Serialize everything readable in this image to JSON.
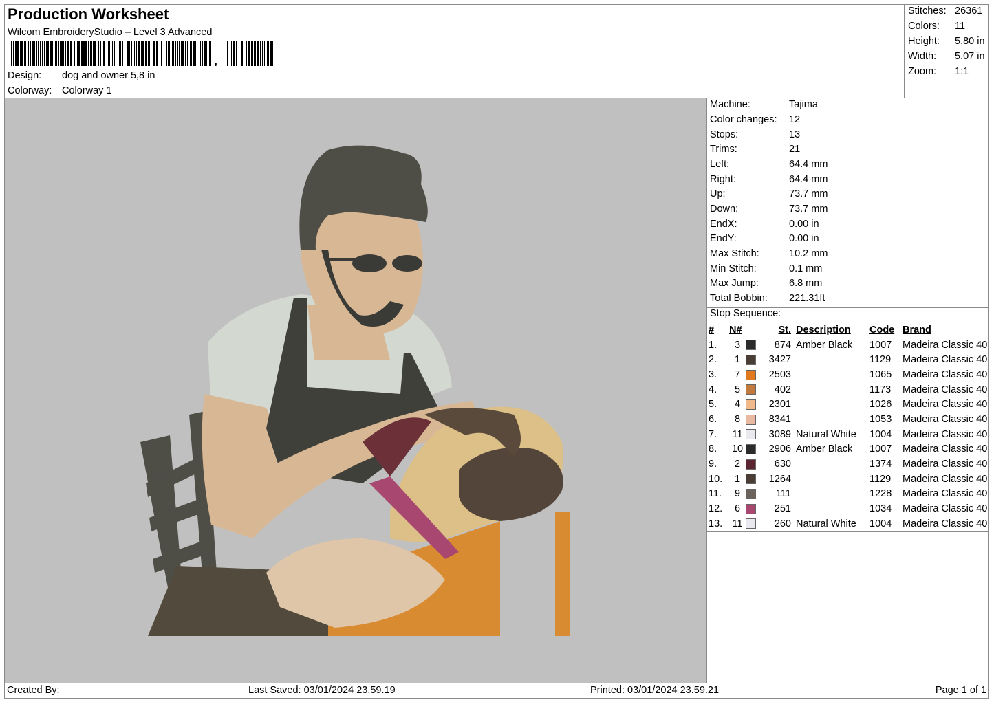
{
  "header": {
    "title": "Production Worksheet",
    "software": "Wilcom EmbroideryStudio – Level 3 Advanced",
    "design_label": "Design:",
    "design_value": "dog and  owner 5,8 in",
    "colorway_label": "Colorway:",
    "colorway_value": "Colorway 1"
  },
  "summary": [
    {
      "label": "Stitches:",
      "value": "26361"
    },
    {
      "label": "Colors:",
      "value": "11"
    },
    {
      "label": "Height:",
      "value": "5.80 in"
    },
    {
      "label": "Width:",
      "value": "5.07 in"
    },
    {
      "label": "Zoom:",
      "value": "1:1"
    }
  ],
  "machine_info": [
    {
      "label": "Machine:",
      "value": "Tajima"
    },
    {
      "label": "Color changes:",
      "value": "12"
    },
    {
      "label": "Stops:",
      "value": "13"
    },
    {
      "label": "Trims:",
      "value": "21"
    },
    {
      "label": "Left:",
      "value": "64.4 mm"
    },
    {
      "label": "Right:",
      "value": "64.4 mm"
    },
    {
      "label": "Up:",
      "value": "73.7 mm"
    },
    {
      "label": "Down:",
      "value": "73.7 mm"
    },
    {
      "label": "EndX:",
      "value": "0.00 in"
    },
    {
      "label": "EndY:",
      "value": "0.00 in"
    },
    {
      "label": "Max Stitch:",
      "value": "10.2 mm"
    },
    {
      "label": "Min Stitch:",
      "value": "0.1 mm"
    },
    {
      "label": "Max Jump:",
      "value": "6.8 mm"
    },
    {
      "label": "Total Bobbin:",
      "value": "221.31ft"
    }
  ],
  "stop_sequence": {
    "title": "Stop Sequence:",
    "columns": [
      "#",
      "N#",
      "St.",
      "Description",
      "Code",
      "Brand"
    ],
    "rows": [
      {
        "num": "1.",
        "n": "3",
        "color": "#2b2b2b",
        "st": "874",
        "desc": "Amber Black",
        "code": "1007",
        "brand": "Madeira Classic 40"
      },
      {
        "num": "2.",
        "n": "1",
        "color": "#4a3d36",
        "st": "3427",
        "desc": "",
        "code": "1129",
        "brand": "Madeira Classic 40"
      },
      {
        "num": "3.",
        "n": "7",
        "color": "#e0781e",
        "st": "2503",
        "desc": "",
        "code": "1065",
        "brand": "Madeira Classic 40"
      },
      {
        "num": "4.",
        "n": "5",
        "color": "#c07a3e",
        "st": "402",
        "desc": "",
        "code": "1173",
        "brand": "Madeira Classic 40"
      },
      {
        "num": "5.",
        "n": "4",
        "color": "#f2b98a",
        "st": "2301",
        "desc": "",
        "code": "1026",
        "brand": "Madeira Classic 40"
      },
      {
        "num": "6.",
        "n": "8",
        "color": "#e8b8a0",
        "st": "8341",
        "desc": "",
        "code": "1053",
        "brand": "Madeira Classic 40"
      },
      {
        "num": "7.",
        "n": "11",
        "color": "#e9e9ef",
        "st": "3089",
        "desc": "Natural White",
        "code": "1004",
        "brand": "Madeira Classic 40"
      },
      {
        "num": "8.",
        "n": "10",
        "color": "#2b2b2b",
        "st": "2906",
        "desc": "Amber Black",
        "code": "1007",
        "brand": "Madeira Classic 40"
      },
      {
        "num": "9.",
        "n": "2",
        "color": "#5c2430",
        "st": "630",
        "desc": "",
        "code": "1374",
        "brand": "Madeira Classic 40"
      },
      {
        "num": "10.",
        "n": "1",
        "color": "#4a3d36",
        "st": "1264",
        "desc": "",
        "code": "1129",
        "brand": "Madeira Classic 40"
      },
      {
        "num": "11.",
        "n": "9",
        "color": "#6a625b",
        "st": "111",
        "desc": "",
        "code": "1228",
        "brand": "Madeira Classic 40"
      },
      {
        "num": "12.",
        "n": "6",
        "color": "#a84870",
        "st": "251",
        "desc": "",
        "code": "1034",
        "brand": "Madeira Classic 40"
      },
      {
        "num": "13.",
        "n": "11",
        "color": "#e9e9ef",
        "st": "260",
        "desc": "Natural White",
        "code": "1004",
        "brand": "Madeira Classic 40"
      }
    ]
  },
  "footer": {
    "created_by": "Created By:",
    "last_saved": "Last Saved: 03/01/2024 23.59.19",
    "printed": "Printed: 03/01/2024 23.59.21",
    "page": "Page 1 of 1"
  }
}
